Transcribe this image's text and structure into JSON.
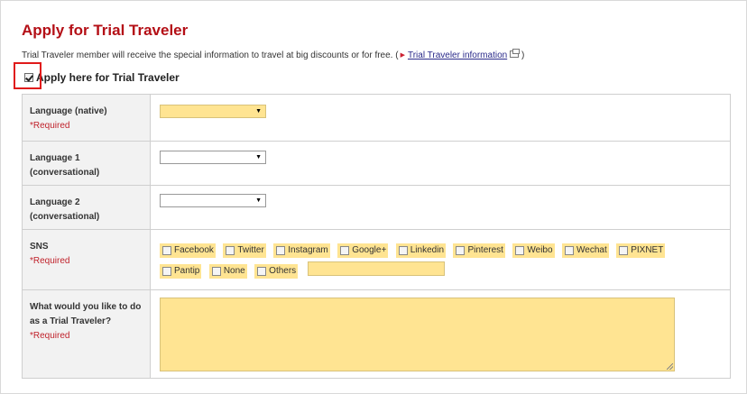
{
  "page": {
    "title": "Apply for Trial Traveler",
    "intro_text": "Trial Traveler member will receive the special information to travel at big discounts or for free. (",
    "intro_link": "Trial Traveler information",
    "intro_close": ")",
    "apply_checkbox_label": "Apply here for Trial Traveler",
    "apply_checked": true
  },
  "form": {
    "required_text": "*Required",
    "language_native": {
      "label": "Language (native)",
      "value": ""
    },
    "language1": {
      "label_line1": "Language 1",
      "label_line2": "(conversational)",
      "value": ""
    },
    "language2": {
      "label_line1": "Language 2",
      "label_line2": "(conversational)",
      "value": ""
    },
    "sns": {
      "label": "SNS",
      "options": [
        "Facebook",
        "Twitter",
        "Instagram",
        "Google+",
        "Linkedin",
        "Pinterest",
        "Weibo",
        "Wechat",
        "PIXNET",
        "Pantip",
        "None",
        "Others"
      ],
      "others_value": ""
    },
    "wish": {
      "label_line1": "What would you like to do",
      "label_line2": "as a Trial Traveler?",
      "value": ""
    }
  },
  "colors": {
    "title": "#b40f16",
    "required": "#c0222b",
    "highlight": "#ffe492",
    "callout": "#e01a1a"
  }
}
